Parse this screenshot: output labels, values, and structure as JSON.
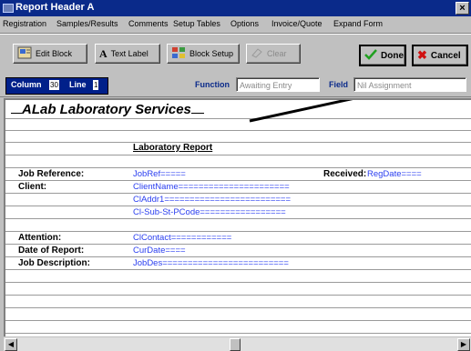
{
  "window": {
    "title": "Report Header A",
    "close_label": "×"
  },
  "menu": [
    "Registration",
    "Samples/Results",
    "Comments",
    "Setup Tables",
    "Options",
    "Invoice/Quote",
    "Expand Form"
  ],
  "toolbar": {
    "edit_block": "Edit Block",
    "text_label": "Text Label",
    "block_setup": "Block Setup",
    "clear": "Clear",
    "done": "Done",
    "cancel": "Cancel"
  },
  "fieldbar": {
    "column_label": "Column",
    "column_value": "30",
    "line_label": "Line",
    "line_value": "1",
    "function_label": "Function",
    "function_value": "Awaiting Entry",
    "field_label": "Field",
    "field_value": "Nil Assignment"
  },
  "report": {
    "company": "ALab Laboratory Services",
    "report_title": "Laboratory Report",
    "job_reference_label": "Job Reference:",
    "job_reference_field": "JobRef=====",
    "received_label": "Received:",
    "received_field": "RegDate====",
    "client_label": "Client:",
    "client_name_field": "ClientName======================",
    "client_addr_field": "ClAddr1=========================",
    "client_sub_field": "Cl-Sub-St-PCode=================",
    "attention_label": "Attention:",
    "attention_field": "ClContact============",
    "date_label": "Date of Report:",
    "date_field": "CurDate====",
    "job_desc_label": "Job Description:",
    "job_desc_field": "JobDes========================="
  },
  "colors": {
    "titlebar": "#0a2a8a",
    "field_text": "#2a3ef0",
    "column_box": "#00208a"
  }
}
